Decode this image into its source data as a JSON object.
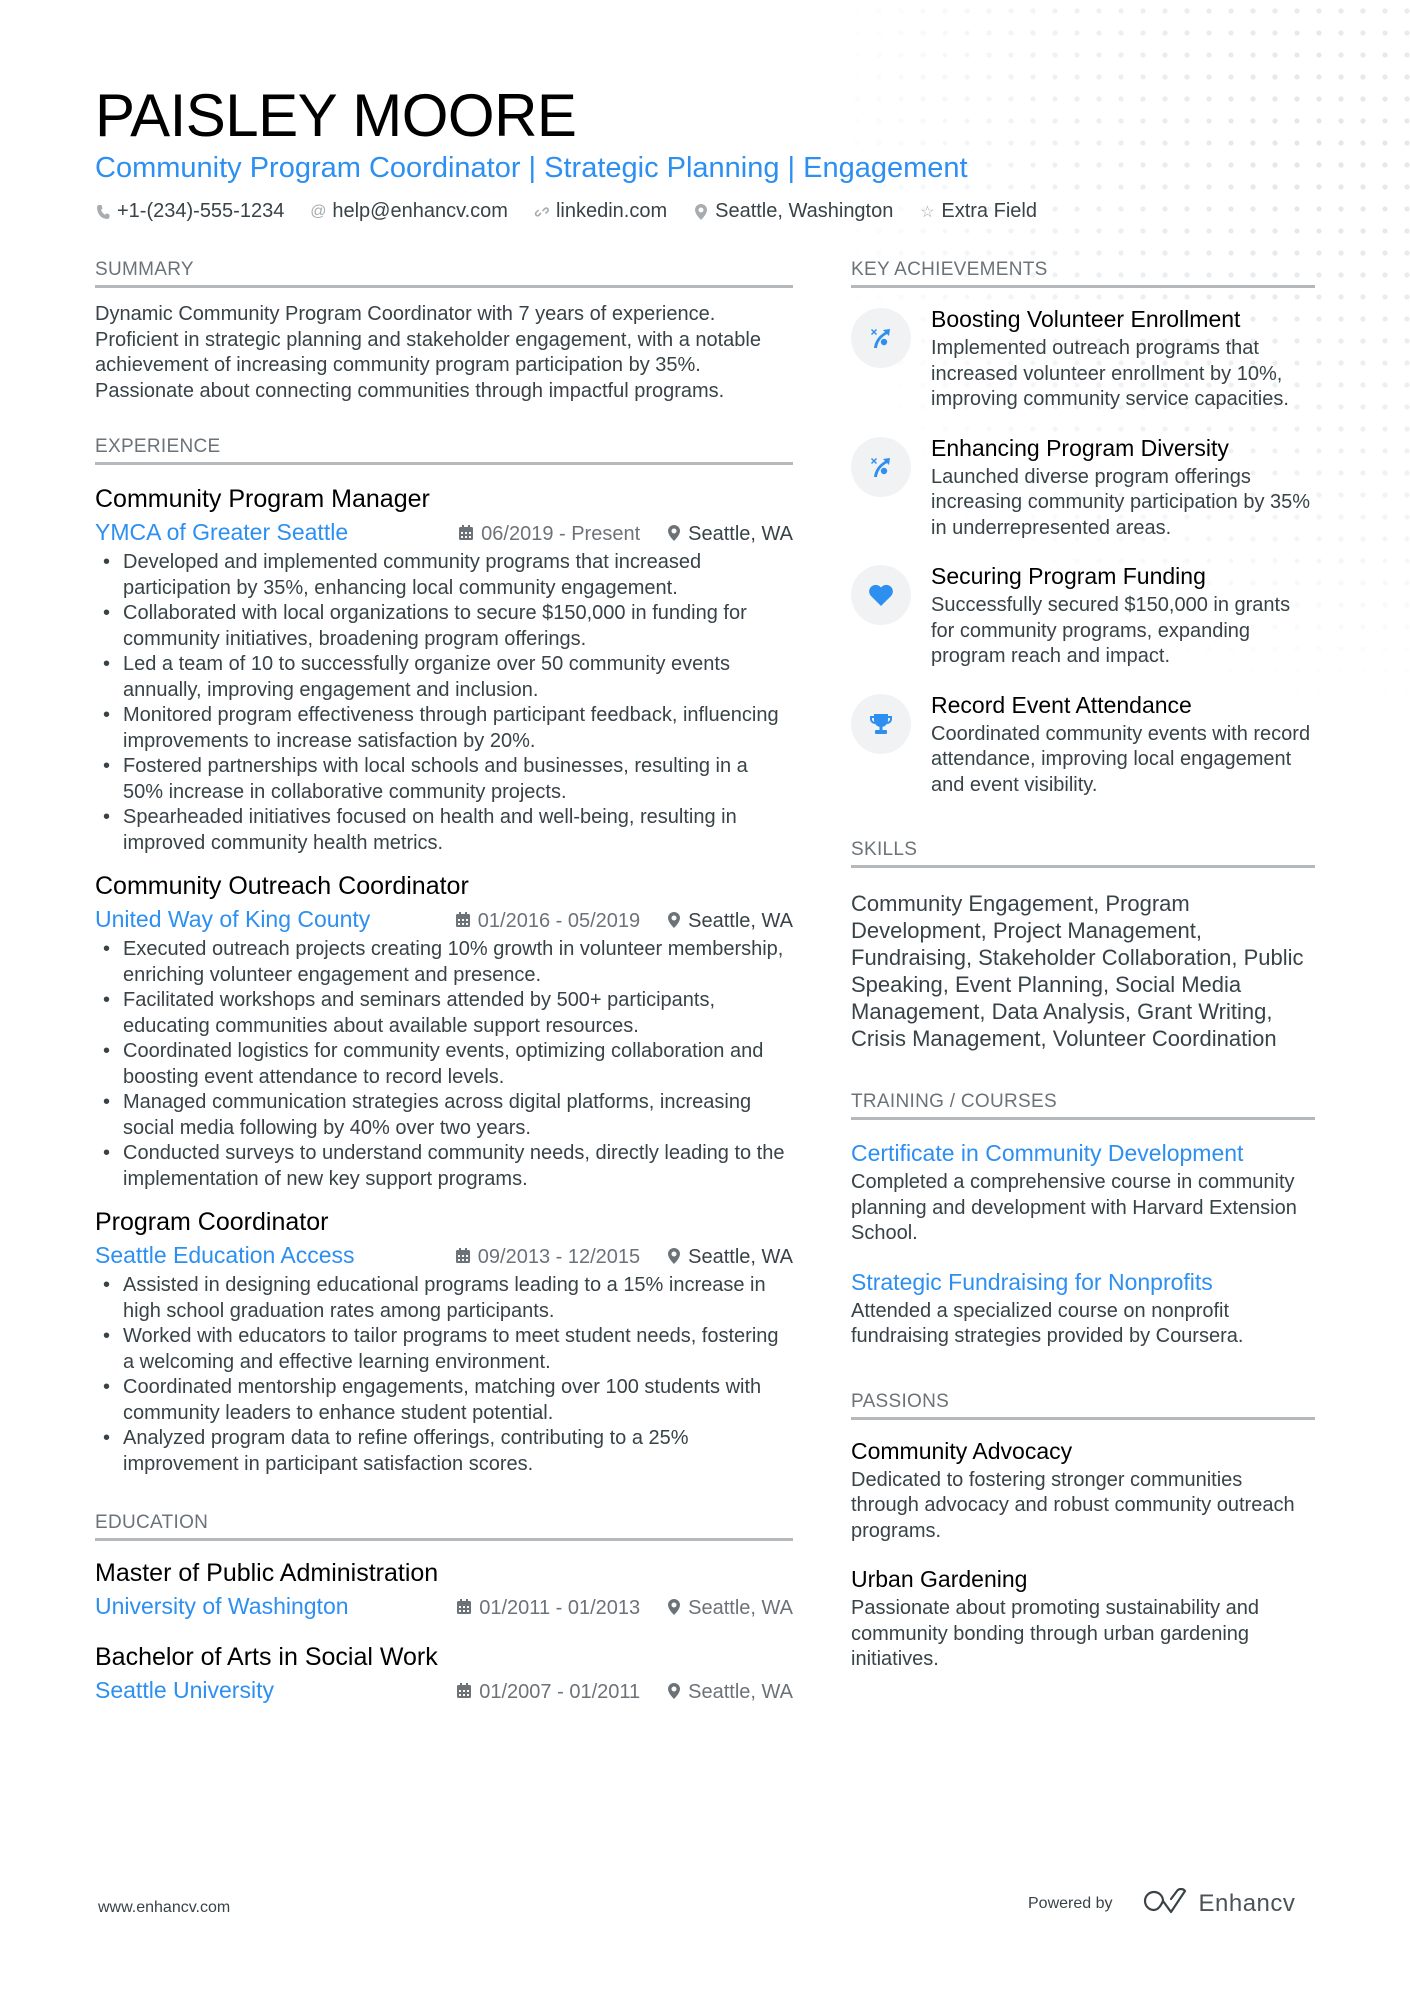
{
  "header": {
    "name": "PAISLEY MOORE",
    "tagline": "Community Program Coordinator | Strategic Planning | Engagement",
    "contacts": [
      {
        "icon": "phone-icon",
        "text": "+1-(234)-555-1234"
      },
      {
        "icon": "at-icon",
        "text": "help@enhancv.com"
      },
      {
        "icon": "link-icon",
        "text": "linkedin.com"
      },
      {
        "icon": "location-pin-icon",
        "text": "Seattle, Washington"
      },
      {
        "icon": "star-icon",
        "text": "Extra Field"
      }
    ]
  },
  "summary": {
    "title": "SUMMARY",
    "text": "Dynamic Community Program Coordinator with 7 years of experience. Proficient in strategic planning and stakeholder engagement, with a notable achievement of increasing community program participation by 35%. Passionate about connecting communities through impactful programs."
  },
  "experience": {
    "title": "EXPERIENCE",
    "jobs": [
      {
        "title": "Community Program Manager",
        "company": "YMCA of Greater Seattle",
        "dates": "06/2019 - Present",
        "location": "Seattle, WA",
        "bullets": [
          "Developed and implemented community programs that increased participation by 35%, enhancing local community engagement.",
          "Collaborated with local organizations to secure $150,000 in funding for community initiatives, broadening program offerings.",
          "Led a team of 10 to successfully organize over 50 community events annually, improving engagement and inclusion.",
          "Monitored program effectiveness through participant feedback, influencing improvements to increase satisfaction by 20%.",
          "Fostered partnerships with local schools and businesses, resulting in a 50% increase in collaborative community projects.",
          "Spearheaded initiatives focused on health and well-being, resulting in improved community health metrics."
        ]
      },
      {
        "title": "Community Outreach Coordinator",
        "company": "United Way of King County",
        "dates": "01/2016 - 05/2019",
        "location": "Seattle, WA",
        "bullets": [
          "Executed outreach projects creating 10% growth in volunteer membership, enriching volunteer engagement and presence.",
          "Facilitated workshops and seminars attended by 500+ participants, educating communities about available support resources.",
          "Coordinated logistics for community events, optimizing collaboration and boosting event attendance to record levels.",
          "Managed communication strategies across digital platforms, increasing social media following by 40% over two years.",
          "Conducted surveys to understand community needs, directly leading to the implementation of new key support programs."
        ]
      },
      {
        "title": "Program Coordinator",
        "company": "Seattle Education Access",
        "dates": "09/2013 - 12/2015",
        "location": "Seattle, WA",
        "bullets": [
          "Assisted in designing educational programs leading to a 15% increase in high school graduation rates among participants.",
          "Worked with educators to tailor programs to meet student needs, fostering a welcoming and effective learning environment.",
          "Coordinated mentorship engagements, matching over 100 students with community leaders to enhance student potential.",
          "Analyzed program data to refine offerings, contributing to a 25% improvement in participant satisfaction scores."
        ]
      }
    ]
  },
  "education": {
    "title": "EDUCATION",
    "items": [
      {
        "degree": "Master of Public Administration",
        "school": "University of Washington",
        "dates": "01/2011 - 01/2013",
        "location": "Seattle, WA"
      },
      {
        "degree": "Bachelor of Arts in Social Work",
        "school": "Seattle University",
        "dates": "01/2007 - 01/2011",
        "location": "Seattle, WA"
      }
    ]
  },
  "achievements": {
    "title": "KEY ACHIEVEMENTS",
    "items": [
      {
        "icon": "strategy-icon",
        "title": "Boosting Volunteer Enrollment",
        "desc": "Implemented outreach programs that increased volunteer enrollment by 10%, improving community service capacities."
      },
      {
        "icon": "strategy-icon",
        "title": "Enhancing Program Diversity",
        "desc": "Launched diverse program offerings increasing community participation by 35% in underrepresented areas."
      },
      {
        "icon": "heart-icon",
        "title": "Securing Program Funding",
        "desc": "Successfully secured $150,000 in grants for community programs, expanding program reach and impact."
      },
      {
        "icon": "trophy-icon",
        "title": "Record Event Attendance",
        "desc": "Coordinated community events with record attendance, improving local engagement and event visibility."
      }
    ]
  },
  "skills": {
    "title": "SKILLS",
    "text": "Community Engagement, Program Development, Project Management, Fundraising, Stakeholder Collaboration, Public Speaking, Event Planning, Social Media Management, Data Analysis, Grant Writing, Crisis Management, Volunteer Coordination"
  },
  "training": {
    "title": "TRAINING / COURSES",
    "items": [
      {
        "title": "Certificate in Community Development",
        "desc": "Completed a comprehensive course in community planning and development with Harvard Extension School."
      },
      {
        "title": "Strategic Fundraising for Nonprofits",
        "desc": "Attended a specialized course on nonprofit fundraising strategies provided by Coursera."
      }
    ]
  },
  "passions": {
    "title": "PASSIONS",
    "items": [
      {
        "title": "Community Advocacy",
        "desc": "Dedicated to fostering stronger communities through advocacy and robust community outreach programs."
      },
      {
        "title": "Urban Gardening",
        "desc": "Passionate about promoting sustainability and community bonding through urban gardening initiatives."
      }
    ]
  },
  "footer": {
    "website": "www.enhancv.com",
    "powered_by": "Powered by",
    "brand": "Enhancv"
  },
  "colors": {
    "accent": "#2d8ff0",
    "text": "#384347",
    "heading": "#000000",
    "section_title": "#6c7378",
    "rule": "#b6b9bc",
    "icon_bg": "#f1f2f3"
  }
}
